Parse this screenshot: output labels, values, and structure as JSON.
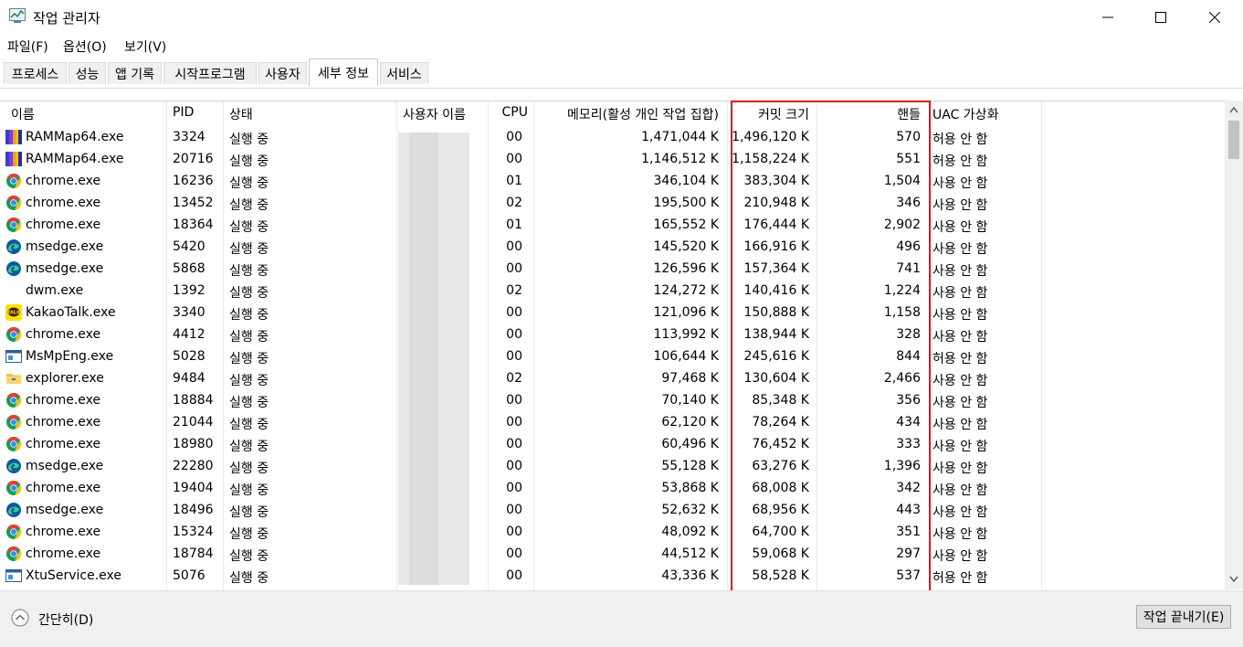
{
  "window": {
    "title": "작업 관리자"
  },
  "menu": {
    "file": "파일(F)",
    "options": "옵션(O)",
    "view": "보기(V)"
  },
  "tabs": [
    "프로세스",
    "성능",
    "앱 기록",
    "시작프로그램",
    "사용자",
    "세부 정보",
    "서비스"
  ],
  "active_tab": "세부 정보",
  "columns": {
    "name": "이름",
    "pid": "PID",
    "status": "상태",
    "user": "사용자 이름",
    "cpu": "CPU",
    "memory": "메모리(활성 개인 작업 집합)",
    "commit": "커밋 크기",
    "handles": "핸들",
    "uac": "UAC 가상화"
  },
  "rows": [
    {
      "icon": "rammap-icon",
      "name": "RAMMap64.exe",
      "pid": "3324",
      "status": "실행 중",
      "cpu": "00",
      "memory": "1,471,044 K",
      "commit": "1,496,120 K",
      "handles": "570",
      "uac": "허용 안 함"
    },
    {
      "icon": "rammap-icon",
      "name": "RAMMap64.exe",
      "pid": "20716",
      "status": "실행 중",
      "cpu": "00",
      "memory": "1,146,512 K",
      "commit": "1,158,224 K",
      "handles": "551",
      "uac": "허용 안 함"
    },
    {
      "icon": "chrome-icon",
      "name": "chrome.exe",
      "pid": "16236",
      "status": "실행 중",
      "cpu": "01",
      "memory": "346,104 K",
      "commit": "383,304 K",
      "handles": "1,504",
      "uac": "사용 안 함"
    },
    {
      "icon": "chrome-icon",
      "name": "chrome.exe",
      "pid": "13452",
      "status": "실행 중",
      "cpu": "02",
      "memory": "195,500 K",
      "commit": "210,948 K",
      "handles": "346",
      "uac": "사용 안 함"
    },
    {
      "icon": "chrome-icon",
      "name": "chrome.exe",
      "pid": "18364",
      "status": "실행 중",
      "cpu": "01",
      "memory": "165,552 K",
      "commit": "176,444 K",
      "handles": "2,902",
      "uac": "사용 안 함"
    },
    {
      "icon": "edge-icon",
      "name": "msedge.exe",
      "pid": "5420",
      "status": "실행 중",
      "cpu": "00",
      "memory": "145,520 K",
      "commit": "166,916 K",
      "handles": "496",
      "uac": "사용 안 함"
    },
    {
      "icon": "edge-icon",
      "name": "msedge.exe",
      "pid": "5868",
      "status": "실행 중",
      "cpu": "00",
      "memory": "126,596 K",
      "commit": "157,364 K",
      "handles": "741",
      "uac": "사용 안 함"
    },
    {
      "icon": "blank-icon",
      "name": "dwm.exe",
      "pid": "1392",
      "status": "실행 중",
      "cpu": "02",
      "memory": "124,272 K",
      "commit": "140,416 K",
      "handles": "1,224",
      "uac": "사용 안 함"
    },
    {
      "icon": "kakao-icon",
      "name": "KakaoTalk.exe",
      "pid": "3340",
      "status": "실행 중",
      "cpu": "00",
      "memory": "121,096 K",
      "commit": "150,888 K",
      "handles": "1,158",
      "uac": "사용 안 함"
    },
    {
      "icon": "chrome-icon",
      "name": "chrome.exe",
      "pid": "4412",
      "status": "실행 중",
      "cpu": "00",
      "memory": "113,992 K",
      "commit": "138,944 K",
      "handles": "328",
      "uac": "사용 안 함"
    },
    {
      "icon": "window-app-icon",
      "name": "MsMpEng.exe",
      "pid": "5028",
      "status": "실행 중",
      "cpu": "00",
      "memory": "106,644 K",
      "commit": "245,616 K",
      "handles": "844",
      "uac": "허용 안 함"
    },
    {
      "icon": "folder-icon",
      "name": "explorer.exe",
      "pid": "9484",
      "status": "실행 중",
      "cpu": "02",
      "memory": "97,468 K",
      "commit": "130,604 K",
      "handles": "2,466",
      "uac": "사용 안 함"
    },
    {
      "icon": "chrome-icon",
      "name": "chrome.exe",
      "pid": "18884",
      "status": "실행 중",
      "cpu": "00",
      "memory": "70,140 K",
      "commit": "85,348 K",
      "handles": "356",
      "uac": "사용 안 함"
    },
    {
      "icon": "chrome-icon",
      "name": "chrome.exe",
      "pid": "21044",
      "status": "실행 중",
      "cpu": "00",
      "memory": "62,120 K",
      "commit": "78,264 K",
      "handles": "434",
      "uac": "사용 안 함"
    },
    {
      "icon": "chrome-icon",
      "name": "chrome.exe",
      "pid": "18980",
      "status": "실행 중",
      "cpu": "00",
      "memory": "60,496 K",
      "commit": "76,452 K",
      "handles": "333",
      "uac": "사용 안 함"
    },
    {
      "icon": "edge-icon",
      "name": "msedge.exe",
      "pid": "22280",
      "status": "실행 중",
      "cpu": "00",
      "memory": "55,128 K",
      "commit": "63,276 K",
      "handles": "1,396",
      "uac": "사용 안 함"
    },
    {
      "icon": "chrome-icon",
      "name": "chrome.exe",
      "pid": "19404",
      "status": "실행 중",
      "cpu": "00",
      "memory": "53,868 K",
      "commit": "68,008 K",
      "handles": "342",
      "uac": "사용 안 함"
    },
    {
      "icon": "edge-icon",
      "name": "msedge.exe",
      "pid": "18496",
      "status": "실행 중",
      "cpu": "00",
      "memory": "52,632 K",
      "commit": "68,956 K",
      "handles": "443",
      "uac": "사용 안 함"
    },
    {
      "icon": "chrome-icon",
      "name": "chrome.exe",
      "pid": "15324",
      "status": "실행 중",
      "cpu": "00",
      "memory": "48,092 K",
      "commit": "64,700 K",
      "handles": "351",
      "uac": "사용 안 함"
    },
    {
      "icon": "chrome-icon",
      "name": "chrome.exe",
      "pid": "18784",
      "status": "실행 중",
      "cpu": "00",
      "memory": "44,512 K",
      "commit": "59,068 K",
      "handles": "297",
      "uac": "사용 안 함"
    },
    {
      "icon": "window-app-icon",
      "name": "XtuService.exe",
      "pid": "5076",
      "status": "실행 중",
      "cpu": "00",
      "memory": "43,336 K",
      "commit": "58,528 K",
      "handles": "537",
      "uac": "허용 안 함"
    }
  ],
  "footer": {
    "collapse": "간단히(D)",
    "end_task": "작업 끝내기(E)"
  },
  "colors": {
    "highlight": "#e01010",
    "chrome_red": "#db4437",
    "chrome_yellow": "#f4c20d",
    "chrome_green": "#0f9d58",
    "chrome_blue": "#4285f4",
    "edge_blue": "#0c59a4",
    "edge_green": "#3ccb8a",
    "kakao_yellow": "#fae100"
  }
}
